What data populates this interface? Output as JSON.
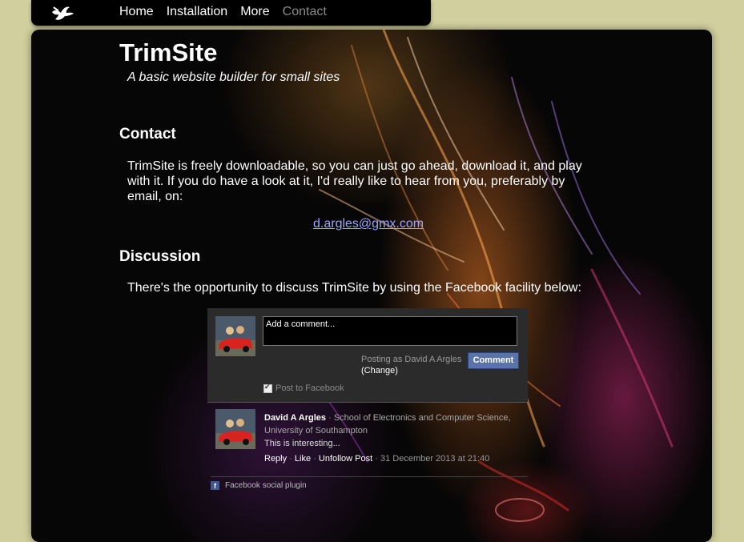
{
  "nav": {
    "items": [
      "Home",
      "Installation",
      "More",
      "Contact"
    ],
    "active": "Contact"
  },
  "header": {
    "title": "TrimSite",
    "subtitle": "A basic website builder for small sites"
  },
  "contact": {
    "heading": "Contact",
    "text": "TrimSite is freely downloadable, so you can just go ahead, download it, and play with it. If you do have a look at it, I'd really like to hear from you, preferably by email, on:",
    "email": "d.argles@gmx.com"
  },
  "discussion": {
    "heading": "Discussion",
    "text": "There's the opportunity to discuss TrimSite by using the Facebook facility below:"
  },
  "facebook": {
    "input_placeholder": "Add a comment...",
    "posting_as": "Posting as David A Argles",
    "change": "(Change)",
    "comment_button": "Comment",
    "post_to_facebook": "Post to Facebook",
    "comment": {
      "author": "David A Argles",
      "affiliation": "School of Electronics and Computer Science, University of Southampton",
      "text": "This is interesting...",
      "actions": [
        "Reply",
        "Like",
        "Unfollow Post"
      ],
      "date": "31 December 2013 at 21:40"
    },
    "footer": "Facebook social plugin"
  },
  "colors": {
    "page_background": "#d2cf9e",
    "link": "#9aa6ff",
    "fb_button": "#5b74a8",
    "nav_active": "#8a8a8a"
  },
  "icons": [
    "bird-logo-icon",
    "checkbox-icon",
    "facebook-icon"
  ]
}
